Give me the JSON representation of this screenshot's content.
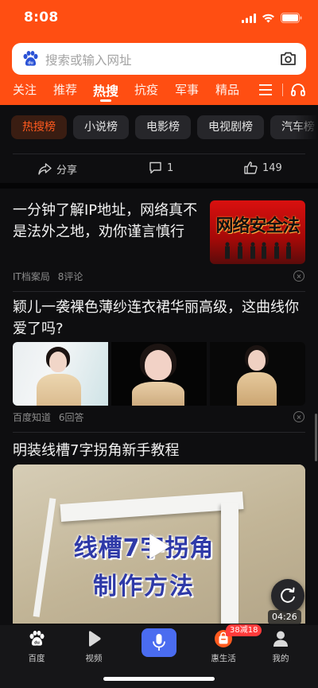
{
  "status_bar": {
    "time": "8:08"
  },
  "search": {
    "placeholder": "搜索或输入网址"
  },
  "top_tabs": [
    "关注",
    "推荐",
    "热搜",
    "抗疫",
    "军事",
    "精品"
  ],
  "active_tab": "热搜",
  "chips": [
    "热搜榜",
    "小说榜",
    "电影榜",
    "电视剧榜",
    "汽车榜"
  ],
  "actions": {
    "share": "分享",
    "comments": "1",
    "likes": "149"
  },
  "feed": [
    {
      "title": "一分钟了解IP地址，网络真不是法外之地，劝你谨言慎行",
      "source": "IT档案局",
      "stat": "8评论",
      "thumb_text": "网络安全法"
    },
    {
      "title": "颖儿一袭裸色薄纱连衣裙华丽高级，这曲线你爱了吗?",
      "source": "百度知道",
      "stat": "6回答"
    },
    {
      "title": "明装线槽7字拐角新手教程",
      "video_text_1": "线槽7字拐角",
      "video_text_2": "制作方法",
      "duration": "04:26"
    }
  ],
  "bottom_nav": {
    "home": "百度",
    "video": "视频",
    "life": "惠生活",
    "mine": "我的",
    "badge": "38减18"
  },
  "colors": {
    "brand_orange": "#ff4e12",
    "mic_blue": "#4a6cf0",
    "badge_red": "#ff3b3b"
  }
}
